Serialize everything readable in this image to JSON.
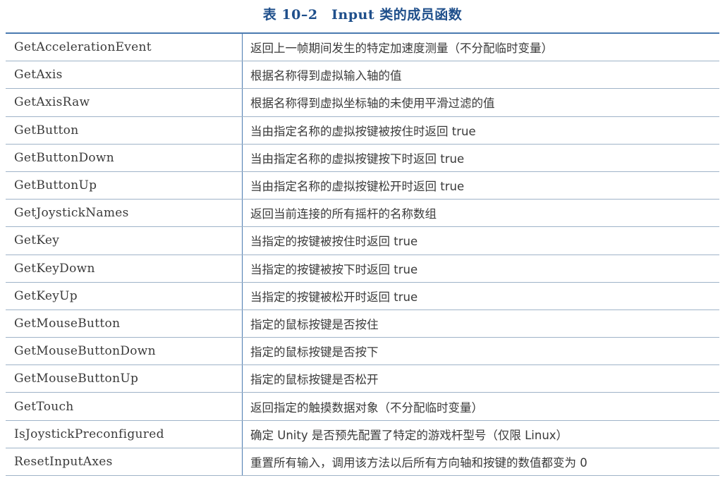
{
  "title": "表 10–2　Input 类的成员函数",
  "rows": [
    {
      "name": "GetAccelerationEvent",
      "desc": "返回上一帧期间发生的特定加速度测量（不分配临时变量）"
    },
    {
      "name": "GetAxis",
      "desc": "根据名称得到虚拟输入轴的值"
    },
    {
      "name": "GetAxisRaw",
      "desc": "根据名称得到虚拟坐标轴的未使用平滑过滤的值"
    },
    {
      "name": "GetButton",
      "desc": "当由指定名称的虚拟按键被按住时返回 true"
    },
    {
      "name": "GetButtonDown",
      "desc": "当由指定名称的虚拟按键按下时返回 true"
    },
    {
      "name": "GetButtonUp",
      "desc": "当由指定名称的虚拟按键松开时返回 true"
    },
    {
      "name": "GetJoystickNames",
      "desc": "返回当前连接的所有摇杆的名称数组"
    },
    {
      "name": "GetKey",
      "desc": "当指定的按键被按住时返回 true"
    },
    {
      "name": "GetKeyDown",
      "desc": "当指定的按键被按下时返回 true"
    },
    {
      "name": "GetKeyUp",
      "desc": "当指定的按键被松开时返回 true"
    },
    {
      "name": "GetMouseButton",
      "desc": "指定的鼠标按键是否按住"
    },
    {
      "name": "GetMouseButtonDown",
      "desc": "指定的鼠标按键是否按下"
    },
    {
      "name": "GetMouseButtonUp",
      "desc": "指定的鼠标按键是否松开"
    },
    {
      "name": "GetTouch",
      "desc": "返回指定的触摸数据对象（不分配临时变量）"
    },
    {
      "name": "IsJoystickPreconfigured",
      "desc": "确定 Unity 是否预先配置了特定的游戏杆型号（仅限 Linux）"
    },
    {
      "name": "ResetInputAxes",
      "desc": "重置所有输入，调用该方法以后所有方向轴和按键的数值都变为 0"
    }
  ]
}
